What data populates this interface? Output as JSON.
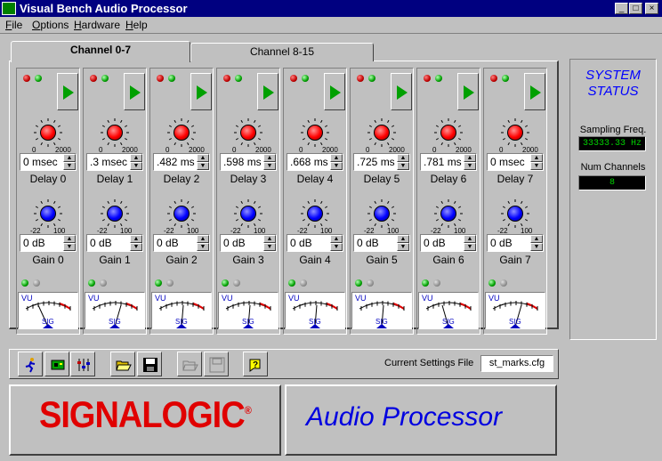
{
  "window": {
    "title": "Visual Bench Audio Processor",
    "min": "_",
    "max": "□",
    "close": "×"
  },
  "menu": [
    {
      "label": "File",
      "key": "F",
      "rest": "ile"
    },
    {
      "label": "Options",
      "key": "O",
      "rest": "ptions"
    },
    {
      "label": "Hardware",
      "key": "H",
      "rest": "ardware"
    },
    {
      "label": "Help",
      "key": "H",
      "rest": "elp"
    }
  ],
  "tabs": [
    {
      "label": "Channel 0-7",
      "active": true
    },
    {
      "label": "Channel 8-15",
      "active": false
    }
  ],
  "knob_ticks": {
    "delay_min": "0",
    "delay_max": "2000",
    "gain_min": "-22",
    "gain_max": "100"
  },
  "meter": {
    "vu": "VU",
    "sig": "SIG"
  },
  "channels": [
    {
      "delay": "0 msec",
      "delay_label": "Delay  0",
      "gain": "0 dB",
      "gain_label": "Gain  0"
    },
    {
      "delay": ".3 msec",
      "delay_label": "Delay  1",
      "gain": "0 dB",
      "gain_label": "Gain  1"
    },
    {
      "delay": ".482 ms",
      "delay_label": "Delay  2",
      "gain": "0 dB",
      "gain_label": "Gain  2"
    },
    {
      "delay": ".598 ms",
      "delay_label": "Delay  3",
      "gain": "0 dB",
      "gain_label": "Gain  3"
    },
    {
      "delay": ".668 ms",
      "delay_label": "Delay  4",
      "gain": "0 dB",
      "gain_label": "Gain  4"
    },
    {
      "delay": ".725 ms",
      "delay_label": "Delay  5",
      "gain": "0 dB",
      "gain_label": "Gain  5"
    },
    {
      "delay": ".781 ms",
      "delay_label": "Delay  6",
      "gain": "0 dB",
      "gain_label": "Gain  6"
    },
    {
      "delay": "0 msec",
      "delay_label": "Delay  7",
      "gain": "0 dB",
      "gain_label": "Gain  7"
    }
  ],
  "status": {
    "title_line1": "SYSTEM",
    "title_line2": "STATUS",
    "sampling_label": "Sampling  Freq.",
    "sampling_value": "33333.33 Hz",
    "channels_label": "Num Channels",
    "channels_value": "8"
  },
  "toolbar": {
    "settings_label": "Current Settings File",
    "settings_file": "st_marks.cfg"
  },
  "branding": {
    "logo": "SIGNALOGIC",
    "logo_mark": "®",
    "product": "Audio Processor"
  },
  "colors": {
    "titlebar": "#000080",
    "accent_red": "#e00000",
    "accent_blue": "#0000e0",
    "led_green": "#00a000"
  }
}
